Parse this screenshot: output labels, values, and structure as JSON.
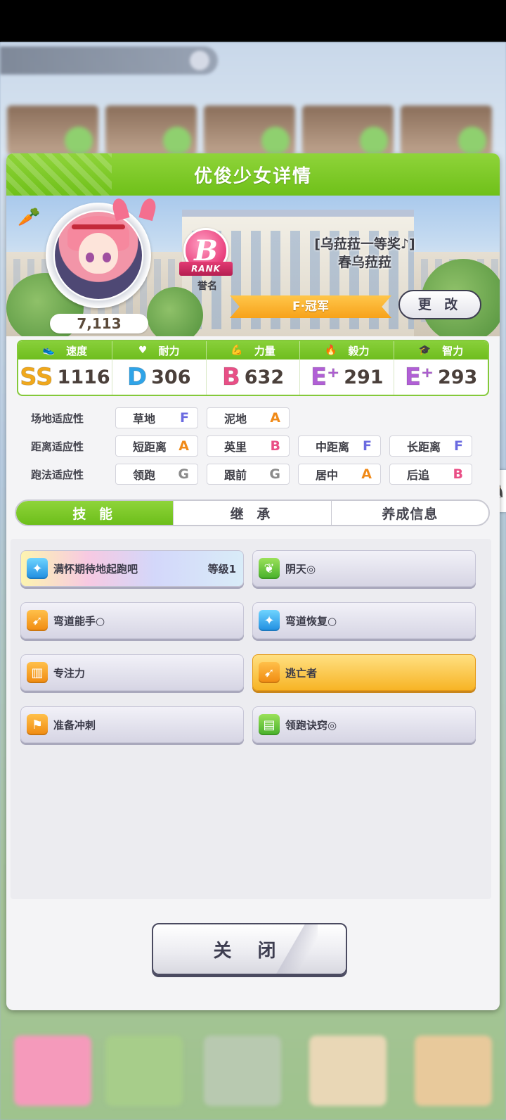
{
  "modal": {
    "title": "优俊少女详情",
    "score": "7,113",
    "rank_letter": "B",
    "rank_word": "RANK",
    "rank_sub": "誉名",
    "epithet": "[乌菈菈一等奖♪]",
    "name": "春乌菈菈",
    "title_ribbon": "F·冠军",
    "change_button": "更 改"
  },
  "stats": [
    {
      "label": "速度",
      "icon": "shoe-icon",
      "grade": "SS",
      "value": "1116",
      "color": "#f0a81c"
    },
    {
      "label": "耐力",
      "icon": "heart-icon",
      "grade": "D",
      "value": "306",
      "color": "#2fa4e8"
    },
    {
      "label": "力量",
      "icon": "arm-icon",
      "grade": "B",
      "value": "632",
      "color": "#e94f86"
    },
    {
      "label": "毅力",
      "icon": "flame-icon",
      "grade": "E⁺",
      "value": "291",
      "color": "#b15fd6"
    },
    {
      "label": "智力",
      "icon": "graduation-cap-icon",
      "grade": "E⁺",
      "value": "293",
      "color": "#b15fd6"
    }
  ],
  "aptitude": {
    "surface": {
      "label": "场地适应性",
      "items": [
        {
          "name": "草地",
          "grade": "F"
        },
        {
          "name": "泥地",
          "grade": "A"
        }
      ]
    },
    "distance": {
      "label": "距离适应性",
      "items": [
        {
          "name": "短距离",
          "grade": "A"
        },
        {
          "name": "英里",
          "grade": "B"
        },
        {
          "name": "中距离",
          "grade": "F"
        },
        {
          "name": "长距离",
          "grade": "F"
        }
      ]
    },
    "style": {
      "label": "跑法适应性",
      "items": [
        {
          "name": "领跑",
          "grade": "G"
        },
        {
          "name": "跟前",
          "grade": "G"
        },
        {
          "name": "居中",
          "grade": "A"
        },
        {
          "name": "后追",
          "grade": "B"
        }
      ]
    }
  },
  "tabs": [
    "技 能",
    "继 承",
    "养成信息"
  ],
  "skills": [
    {
      "name": "满怀期待地起跑吧",
      "level": "等级1",
      "icon": "sparkle-icon",
      "style": "rainbow"
    },
    {
      "name": "阴天◎",
      "level": "",
      "icon": "leaf-icon",
      "style": "normal"
    },
    {
      "name": "弯道能手○",
      "level": "",
      "icon": "runner-icon",
      "style": "normal"
    },
    {
      "name": "弯道恢复○",
      "level": "",
      "icon": "sparkle-icon",
      "style": "normal"
    },
    {
      "name": "专注力",
      "level": "",
      "icon": "gate-icon",
      "style": "normal"
    },
    {
      "name": "逃亡者",
      "level": "",
      "icon": "runner-icon",
      "style": "gold"
    },
    {
      "name": "准备冲刺",
      "level": "",
      "icon": "flag-icon",
      "style": "normal"
    },
    {
      "name": "领跑诀窍◎",
      "level": "",
      "icon": "book-icon",
      "style": "normal"
    }
  ],
  "close_button": "关 闭"
}
